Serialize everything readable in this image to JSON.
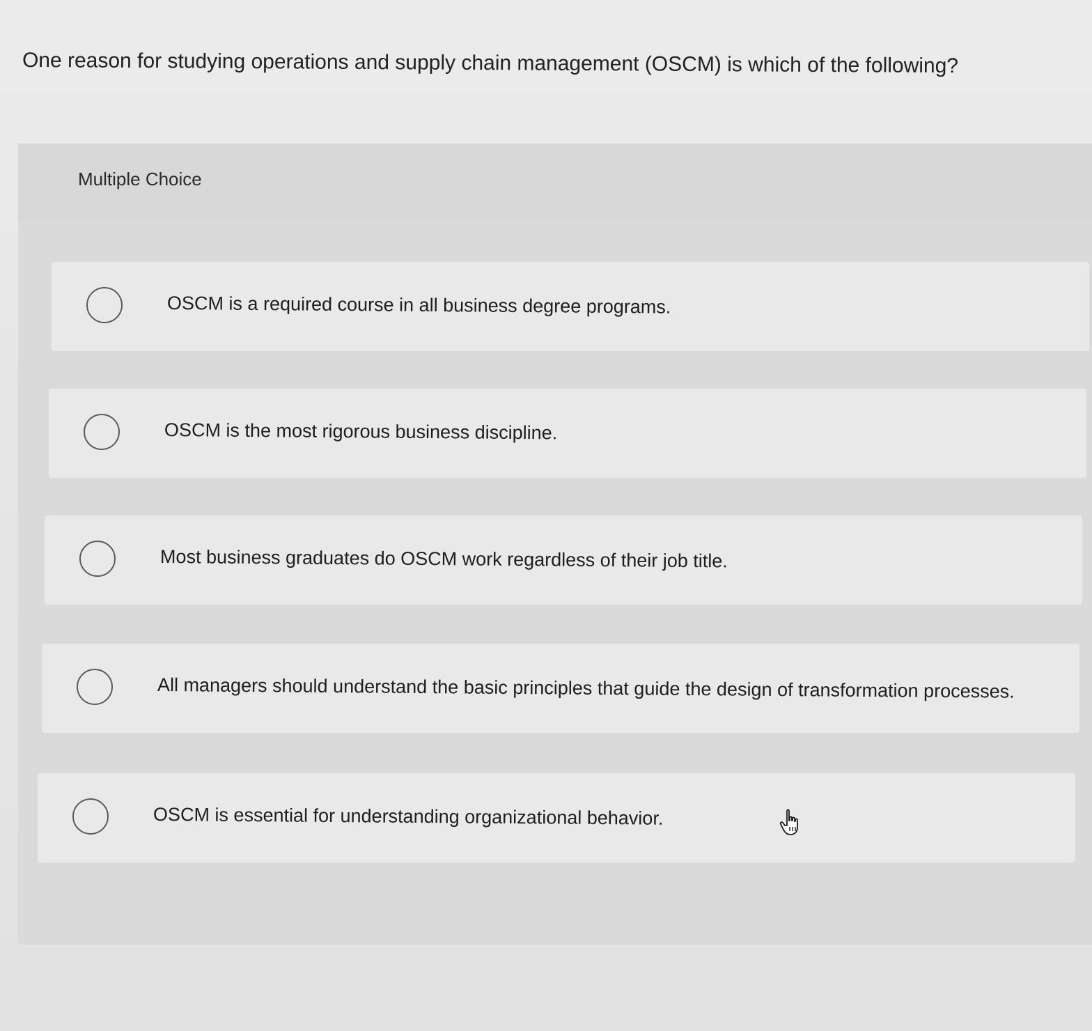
{
  "question": {
    "text": "One reason for studying operations and supply chain management (OSCM) is which of the following?"
  },
  "quiz": {
    "type_label": "Multiple Choice",
    "options": [
      {
        "label": "OSCM is a required course in all business degree programs.",
        "selected": false
      },
      {
        "label": "OSCM is the most rigorous business discipline.",
        "selected": false
      },
      {
        "label": "Most business graduates do OSCM work regardless of their job title.",
        "selected": false
      },
      {
        "label": "All managers should understand the basic principles that guide the design of transformation processes.",
        "selected": false
      },
      {
        "label": "OSCM is essential for understanding organizational behavior.",
        "selected": false
      }
    ]
  },
  "pointer": {
    "icon": "hand-pointer-icon"
  },
  "colors": {
    "page_background": "#e6e6e6",
    "panel_background": "#dadada",
    "option_background": "#e9e9e9",
    "radio_border": "#5a5a5a",
    "text": "#1f1f1f"
  }
}
